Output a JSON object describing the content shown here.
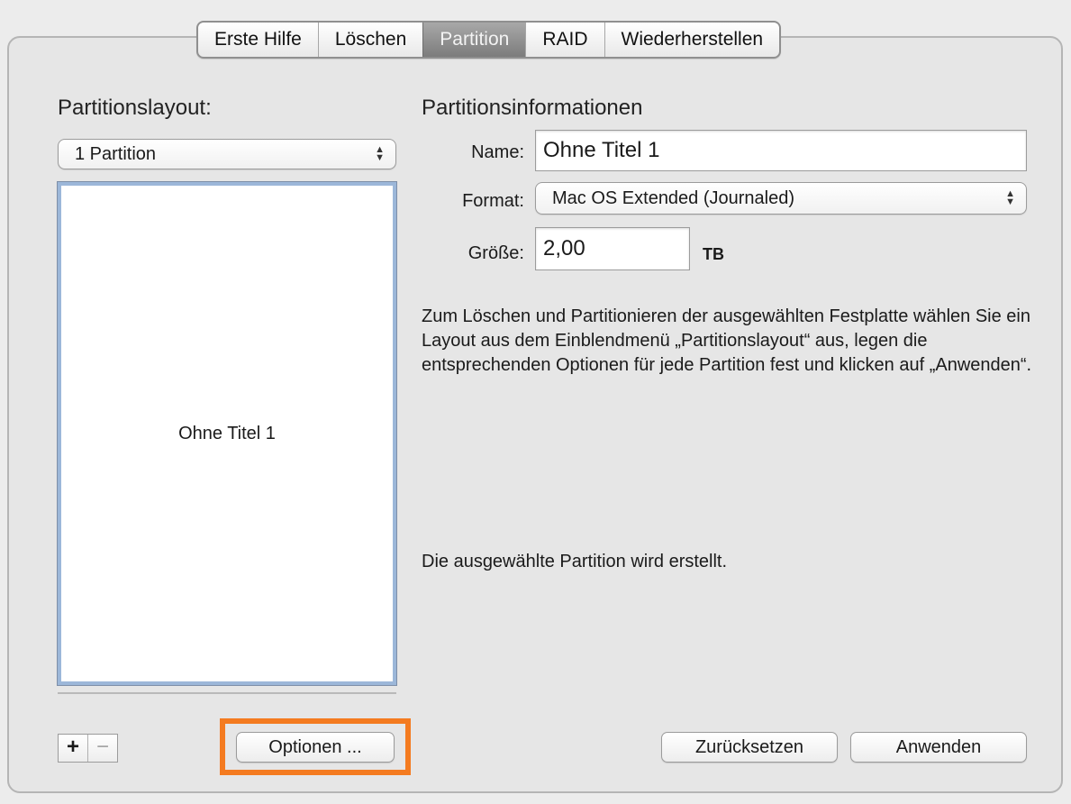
{
  "tabs": [
    {
      "label": "Erste Hilfe"
    },
    {
      "label": "Löschen"
    },
    {
      "label": "Partition"
    },
    {
      "label": "RAID"
    },
    {
      "label": "Wiederherstellen"
    }
  ],
  "active_tab": "Partition",
  "left": {
    "layout_label": "Partitionslayout:",
    "layout_value": "1 Partition",
    "partition_name": "Ohne Titel 1",
    "add_label": "+",
    "remove_label": "−",
    "options_label": "Optionen ..."
  },
  "right": {
    "section_title": "Partitionsinformationen",
    "name_label": "Name:",
    "name_value": "Ohne Titel 1",
    "format_label": "Format:",
    "format_value": "Mac OS Extended (Journaled)",
    "size_label": "Größe:",
    "size_value": "2,00",
    "size_unit": "TB",
    "description": "Zum Löschen und Partitionieren der ausgewählten Festplatte wählen Sie ein Layout aus dem Einblendmenü „Partitionslayout“ aus, legen die entsprechenden Optionen für jede Partition fest und klicken auf „Anwenden“.",
    "status": "Die ausgewählte Partition wird erstellt.",
    "reset_label": "Zurücksetzen",
    "apply_label": "Anwenden"
  },
  "colors": {
    "highlight": "#f47b20",
    "selection_border": "#9cb7d9"
  }
}
